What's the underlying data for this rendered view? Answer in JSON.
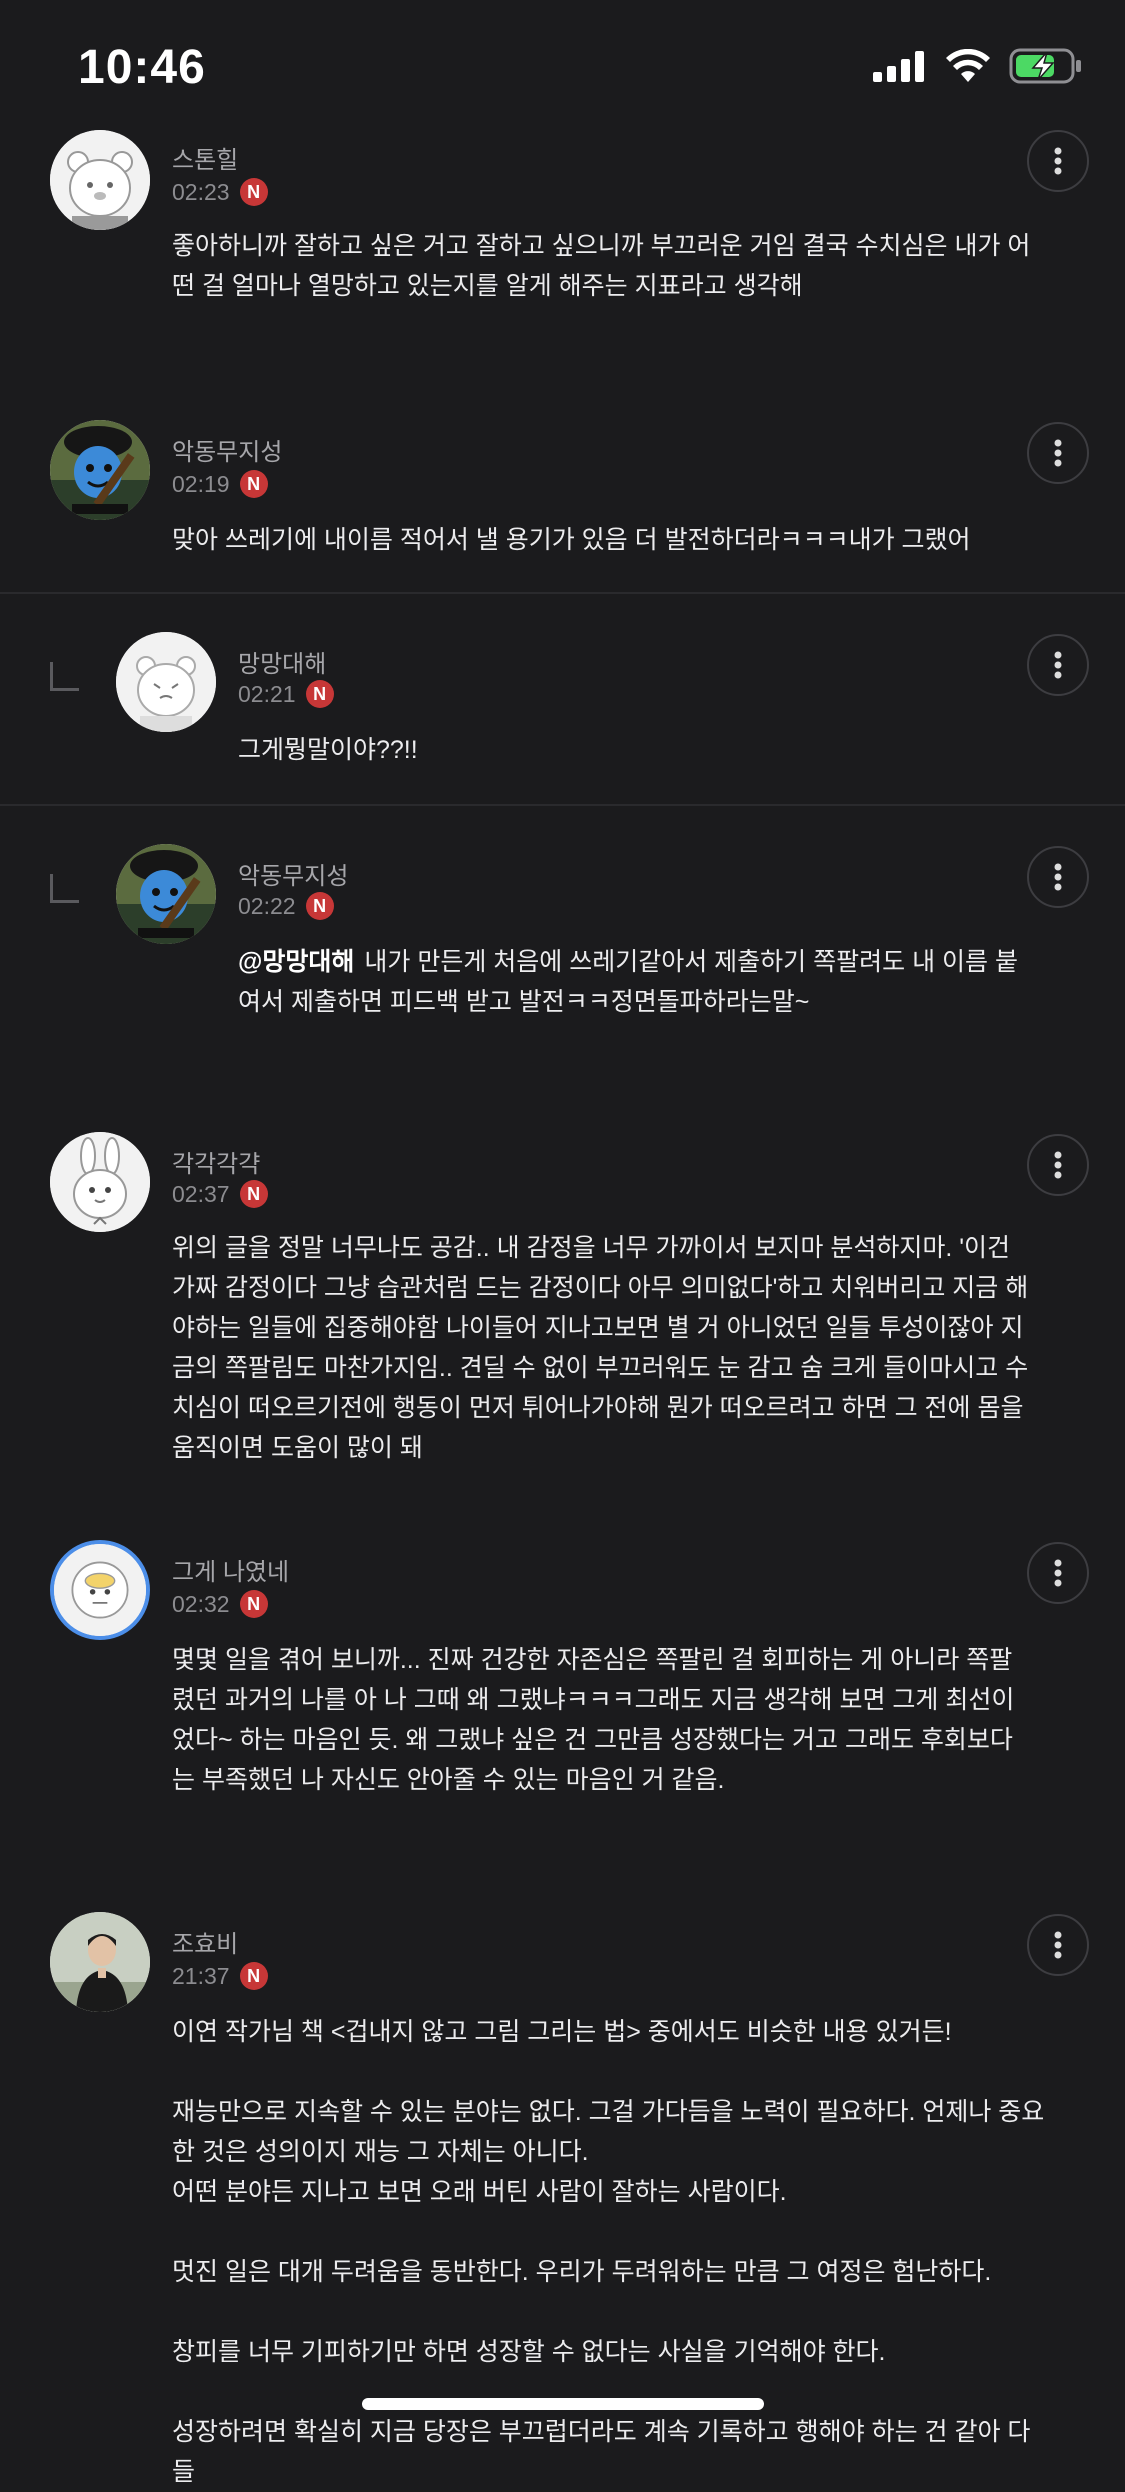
{
  "status_bar": {
    "time": "10:46"
  },
  "comments": [
    {
      "name": "스톤힐",
      "time": "02:23",
      "badge": "N",
      "paragraphs": [
        "좋아하니까 잘하고 싶은 거고 잘하고 싶으니까 부끄러운 거임 결국 수치심은 내가 어떤 걸 얼마나 열망하고 있는지를 알게 해주는 지표라고 생각해"
      ]
    },
    {
      "name": "악동무지성",
      "time": "02:19",
      "badge": "N",
      "paragraphs": [
        "맞아 쓰레기에 내이름 적어서 낼 용기가 있음 더 발전하더라ㅋㅋㅋ내가 그랬어"
      ]
    },
    {
      "name": "망망대해",
      "time": "02:21",
      "badge": "N",
      "paragraphs": [
        "그게뭥말이야??!!"
      ]
    },
    {
      "name": "악동무지성",
      "time": "02:22",
      "badge": "N",
      "mention": "@망망대해",
      "paragraphs": [
        "내가 만든게 처음에 쓰레기같아서 제출하기 쪽팔려도 내 이름 붙여서 제출하면 피드백 받고 발전ㅋㅋ정면돌파하라는말~"
      ]
    },
    {
      "name": "각각각갹",
      "time": "02:37",
      "badge": "N",
      "paragraphs": [
        "위의 글을 정말 너무나도 공감.. 내 감정을 너무 가까이서 보지마 분석하지마. '이건 가짜 감정이다 그냥 습관처럼 드는 감정이다 아무 의미없다'하고 치워버리고 지금 해야하는 일들에 집중해야함 나이들어 지나고보면 별 거 아니었던 일들 투성이잖아 지금의 쪽팔림도 마찬가지임.. 견딜 수 없이 부끄러워도 눈 감고 숨 크게 들이마시고 수치심이 떠오르기전에 행동이 먼저 튀어나가야해 뭔가 떠오르려고 하면 그 전에 몸을 움직이면 도움이 많이 돼"
      ]
    },
    {
      "name": "그게 나였네",
      "time": "02:32",
      "badge": "N",
      "paragraphs": [
        "몇몇 일을 겪어 보니까... 진짜 건강한 자존심은 쪽팔린 걸 회피하는 게 아니라 쪽팔렸던 과거의 나를 아 나 그때 왜 그랬냐ㅋㅋㅋ그래도 지금 생각해 보면 그게 최선이었다~ 하는 마음인 듯. 왜 그랬냐 싶은 건 그만큼 성장했다는 거고 그래도 후회보다는 부족했던 나 자신도 안아줄 수 있는 마음인 거 같음."
      ]
    },
    {
      "name": "조효비",
      "time": "21:37",
      "badge": "N",
      "paragraphs": [
        "이연 작가님 책 <겁내지 않고 그림 그리는 법> 중에서도 비슷한 내용 있거든!",
        "",
        "재능만으로 지속할 수 있는 분야는 없다. 그걸 가다듬을 노력이 필요하다. 언제나 중요한 것은 성의이지 재능 그 자체는 아니다.",
        "어떤 분야든 지나고 보면 오래 버틴 사람이 잘하는 사람이다.",
        "",
        "멋진 일은 대개 두려움을 동반한다. 우리가 두려워하는 만큼 그 여정은 험난하다.",
        "",
        "창피를 너무 기피하기만 하면 성장할 수 없다는 사실을 기억해야 한다.",
        "",
        "성장하려면 확실히 지금 당장은 부끄럽더라도 계속 기록하고 행해야 하는 건 같아 다들"
      ]
    }
  ]
}
